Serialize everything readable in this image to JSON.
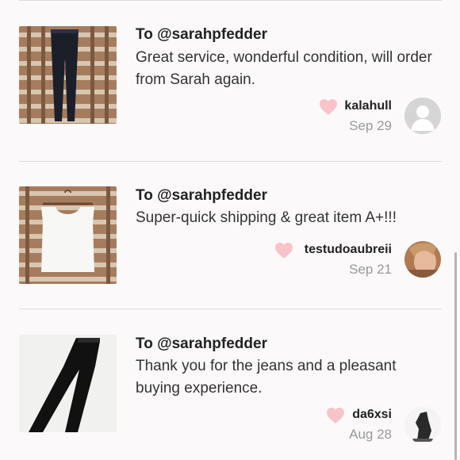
{
  "reviews": [
    {
      "to": "To @sarahpfedder",
      "message": "Great service, wonderful condition, will order from Sarah again.",
      "reviewer": "kalahull",
      "date": "Sep 29",
      "thumb_icon": "black-leggings-photo",
      "avatar_icon": "default-user-avatar"
    },
    {
      "to": "To @sarahpfedder",
      "message": "Super-quick shipping & great item A+!!!",
      "reviewer": "testudoaubreii",
      "date": "Sep 21",
      "thumb_icon": "white-tank-top-photo",
      "avatar_icon": "user-photo-avatar"
    },
    {
      "to": "To @sarahpfedder",
      "message": "Thank you for the jeans and a pleasant buying experience.",
      "reviewer": "da6xsi",
      "date": "Aug 28",
      "thumb_icon": "black-jeans-photo",
      "avatar_icon": "user-photo-avatar"
    }
  ],
  "colors": {
    "background": "#fbf9fa",
    "heart": "#f8c3c9",
    "divider": "#dcdcdc",
    "date_text": "#999999"
  }
}
